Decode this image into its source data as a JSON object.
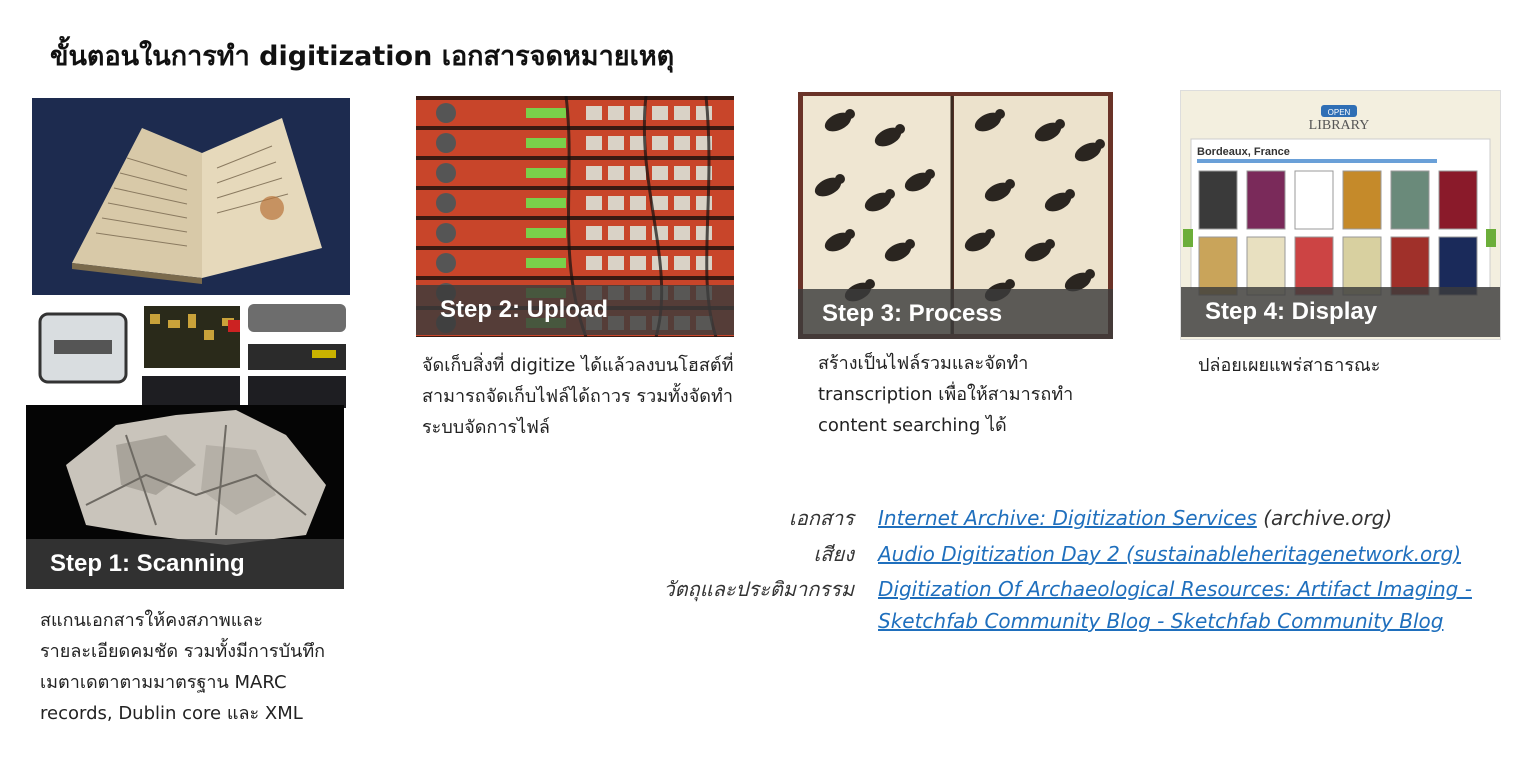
{
  "page": {
    "title": "ขั้นตอนในการทำ digitization เอกสารจดหมายเหตุ"
  },
  "steps": [
    {
      "caption": "Step 1: Scanning",
      "description": [
        "สแกนเอกสารให้คงสภาพและ",
        "รายละเอียดคมชัด รวมทั้งมีการบันทึก",
        "เมตาเดตาตามมาตรฐาน MARC",
        "records, Dublin core และ XML"
      ]
    },
    {
      "caption": "Step 2: Upload",
      "description": [
        "จัดเก็บสิ่งที่ digitize ได้แล้วลงบนโฮสต์ที่",
        "สามารถจัดเก็บไฟล์ได้ถาวร รวมทั้งจัดทำ",
        "ระบบจัดการไฟล์"
      ]
    },
    {
      "caption": "Step 3: Process",
      "description": [
        "สร้างเป็นไฟล์รวมและจัดทำ",
        "transcription เพื่อให้สามารถทำ",
        "content searching ได้"
      ]
    },
    {
      "caption": "Step 4: Display",
      "description": [
        "ปล่อยเผยแพร่สาธารณะ"
      ]
    }
  ],
  "library_screen": {
    "logo_top": "OPEN",
    "logo": "LIBRARY",
    "heading": "Bordeaux, France"
  },
  "references": [
    {
      "label": "เอกสาร",
      "link": "Internet Archive: Digitization Services",
      "tail": " (archive.org)"
    },
    {
      "label": "เสียง",
      "link": "Audio Digitization Day 2 (sustainableheritagenetwork.org)",
      "tail": ""
    },
    {
      "label": "วัตถุและประติมากรรม",
      "link": "Digitization Of Archaeological Resources: Artifact Imaging -",
      "link2": "Sketchfab Community Blog - Sketchfab Community Blog",
      "tail": ""
    }
  ],
  "colors": {
    "link": "#1f6fbd",
    "server_red": "#c8452a",
    "caption_bar": "#3c3c3c"
  }
}
